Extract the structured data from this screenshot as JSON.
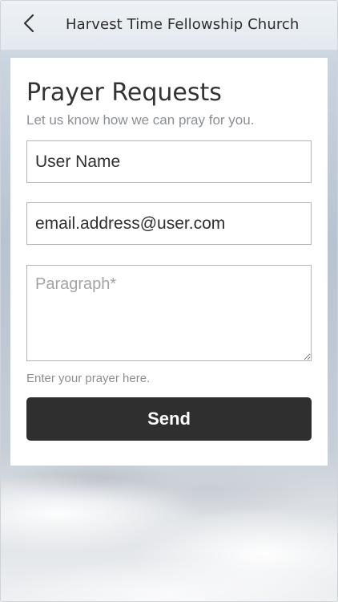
{
  "header": {
    "title": "Harvest Time Fellowship Church",
    "back_icon": "chevron-left-icon"
  },
  "form": {
    "title": "Prayer Requests",
    "subtitle": "Let us know how we can pray for you.",
    "name_value": "User Name",
    "email_value": "email.address@user.com",
    "paragraph_placeholder": "Paragraph*",
    "helper_text": "Enter your prayer here.",
    "send_label": "Send"
  },
  "colors": {
    "button_bg": "#2f2f2f",
    "card_bg": "#ffffff",
    "subtitle": "#8b8f93"
  }
}
